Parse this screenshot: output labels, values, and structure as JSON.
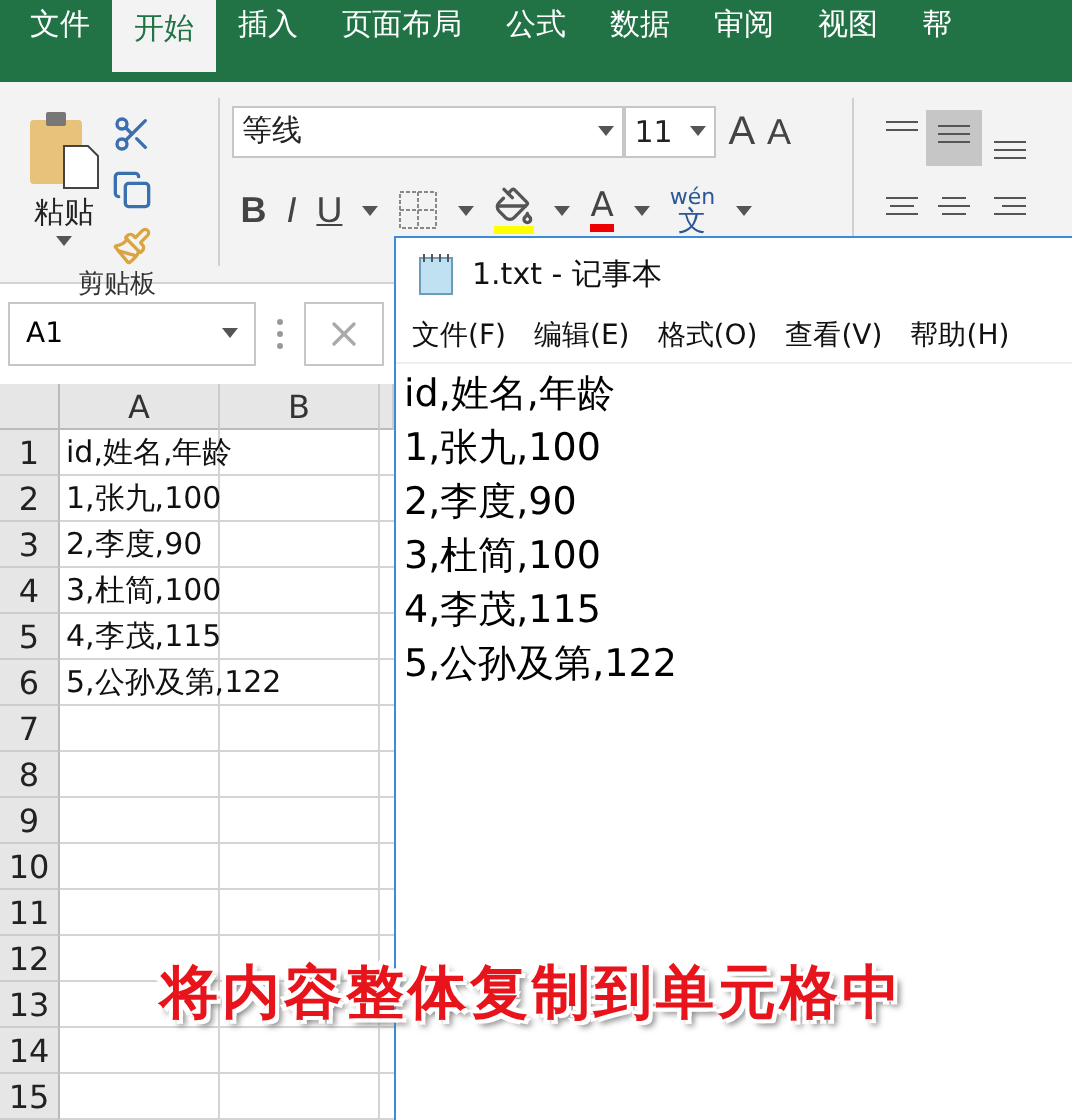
{
  "ribbon_tabs": [
    {
      "label": "文件",
      "selected": false
    },
    {
      "label": "开始",
      "selected": true
    },
    {
      "label": "插入",
      "selected": false
    },
    {
      "label": "页面布局",
      "selected": false
    },
    {
      "label": "公式",
      "selected": false
    },
    {
      "label": "数据",
      "selected": false
    },
    {
      "label": "审阅",
      "selected": false
    },
    {
      "label": "视图",
      "selected": false
    },
    {
      "label": "帮",
      "selected": false
    }
  ],
  "clipboard": {
    "paste": "粘贴",
    "group": "剪贴板"
  },
  "font": {
    "name": "等线",
    "size": "11",
    "grow": "A",
    "shrink": "A",
    "bold": "B",
    "italic": "I",
    "underline": "U",
    "color_letter": "A",
    "phonetic_top": "wén",
    "phonetic": "文"
  },
  "name_box": "A1",
  "sheet": {
    "columns": [
      "A",
      "B"
    ],
    "rows": [
      {
        "number": "1",
        "cell": "id,姓名,年龄"
      },
      {
        "number": "2",
        "cell": "1,张九,100"
      },
      {
        "number": "3",
        "cell": "2,李度,90"
      },
      {
        "number": "4",
        "cell": "3,杜简,100"
      },
      {
        "number": "5",
        "cell": "4,李茂,115"
      },
      {
        "number": "6",
        "cell": "5,公孙及第,122"
      },
      {
        "number": "7"
      },
      {
        "number": "8"
      },
      {
        "number": "9"
      },
      {
        "number": "10"
      },
      {
        "number": "11"
      },
      {
        "number": "12"
      },
      {
        "number": "13"
      },
      {
        "number": "14"
      },
      {
        "number": "15"
      }
    ]
  },
  "notepad": {
    "title": "1.txt - 记事本",
    "menu": [
      "文件(F)",
      "编辑(E)",
      "格式(O)",
      "查看(V)",
      "帮助(H)"
    ],
    "lines": [
      "id,姓名,年龄",
      "1,张九,100",
      "2,李度,90",
      "3,杜简,100",
      "4,李茂,115",
      "5,公孙及第,122"
    ]
  },
  "caption": "将内容整体复制到单元格中"
}
